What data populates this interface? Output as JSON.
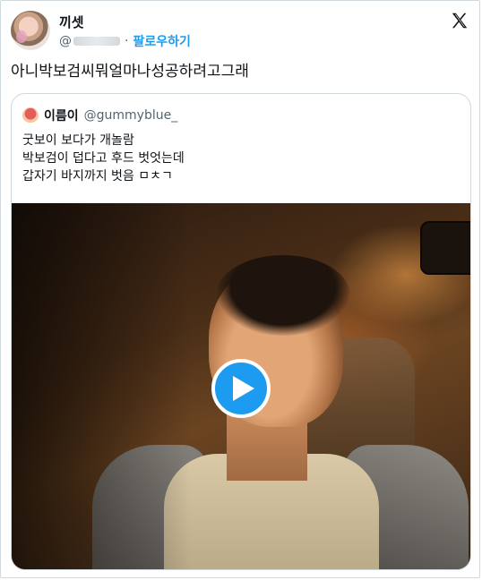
{
  "author": {
    "name": "끼셋",
    "handle_prefix": "@",
    "follow_label": "팔로우하기",
    "separator": "·"
  },
  "tweet": {
    "text": "아니박보검씨뭐얼마나성공하려고그래"
  },
  "quoted_tweet": {
    "name": "이름이",
    "handle": "@gummyblue_",
    "lines": [
      "굿보이 보다가 개놀람",
      "박보검이 덥다고 후드 벗엇는데",
      "갑자기 바지까지 벗음 ㅁㅊㄱ"
    ]
  },
  "icons": {
    "platform_logo": "x-logo-icon",
    "play": "play-icon"
  },
  "colors": {
    "accent": "#1d9bf0",
    "text": "#0f1419",
    "muted": "#536471",
    "border": "#cfd9de"
  }
}
